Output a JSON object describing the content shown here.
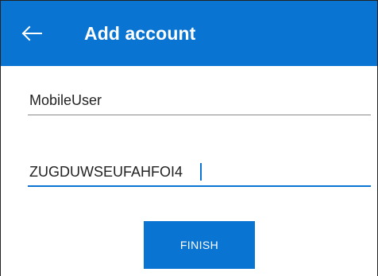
{
  "app_bar": {
    "title": "Add account",
    "back_icon": "arrow-left-icon",
    "color": "#0a74d2"
  },
  "form": {
    "username_value": "MobileUser",
    "secret_value": "ZUGDUWSEUFAHFOI4"
  },
  "actions": {
    "finish_label": "FINISH"
  }
}
